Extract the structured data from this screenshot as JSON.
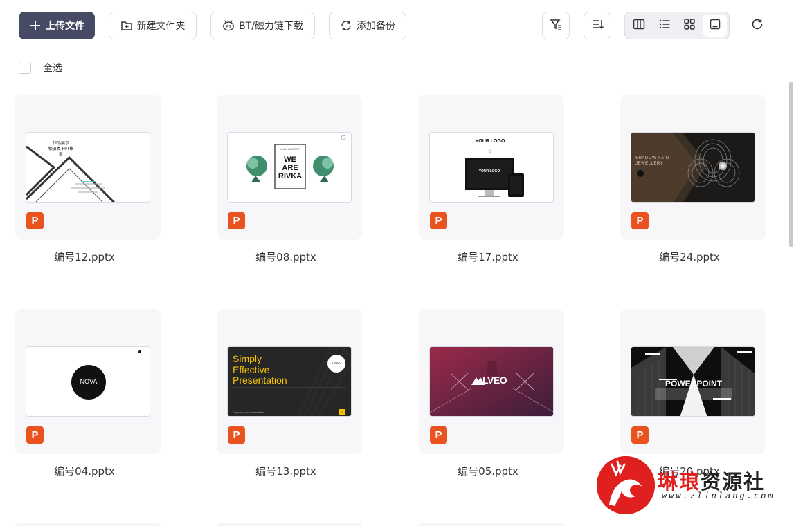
{
  "toolbar": {
    "upload_label": "上传文件",
    "new_folder_label": "新建文件夹",
    "bt_label": "BT/磁力链下载",
    "backup_label": "添加备份"
  },
  "select_all_label": "全选",
  "files": [
    {
      "name": "编号12.pptx",
      "type": "P"
    },
    {
      "name": "编号08.pptx",
      "type": "P"
    },
    {
      "name": "编号17.pptx",
      "type": "P"
    },
    {
      "name": "编号24.pptx",
      "type": "P"
    },
    {
      "name": "编号04.pptx",
      "type": "P"
    },
    {
      "name": "编号13.pptx",
      "type": "P"
    },
    {
      "name": "编号05.pptx",
      "type": "P"
    },
    {
      "name": "编号20.pptx",
      "type": "P"
    }
  ],
  "slides": {
    "s12": {
      "t1": "作品展示",
      "t2": "相册类 PPT模板"
    },
    "s08": {
      "small": "hello! WHAT'S?",
      "big1": "WE",
      "big2": "ARE",
      "big3": "RIVKA"
    },
    "s17": {
      "logo": "YOUR LOGO",
      "screen_logo": "YOUR LOGO"
    },
    "s24": {
      "t1": "SHADOW RAIN",
      "t2": "JEWELLERY"
    },
    "s04": {
      "brand": "NOVA"
    },
    "s13": {
      "l1": "Simply",
      "l2": "Effective",
      "l3": "Presentation",
      "logo": "LOGO",
      "foot": "Company name Presentation",
      "page": "01"
    },
    "s05": {
      "brand": "LVEO"
    },
    "s20": {
      "title": "POWERPOINT"
    }
  },
  "watermark": {
    "title_red": "琳琅",
    "title_black": "资源社",
    "url": "www.zlinlang.com"
  },
  "colors": {
    "primary_button": "#474a65",
    "ppt_icon": "#e8531f",
    "card_bg": "#f7f7f9"
  }
}
